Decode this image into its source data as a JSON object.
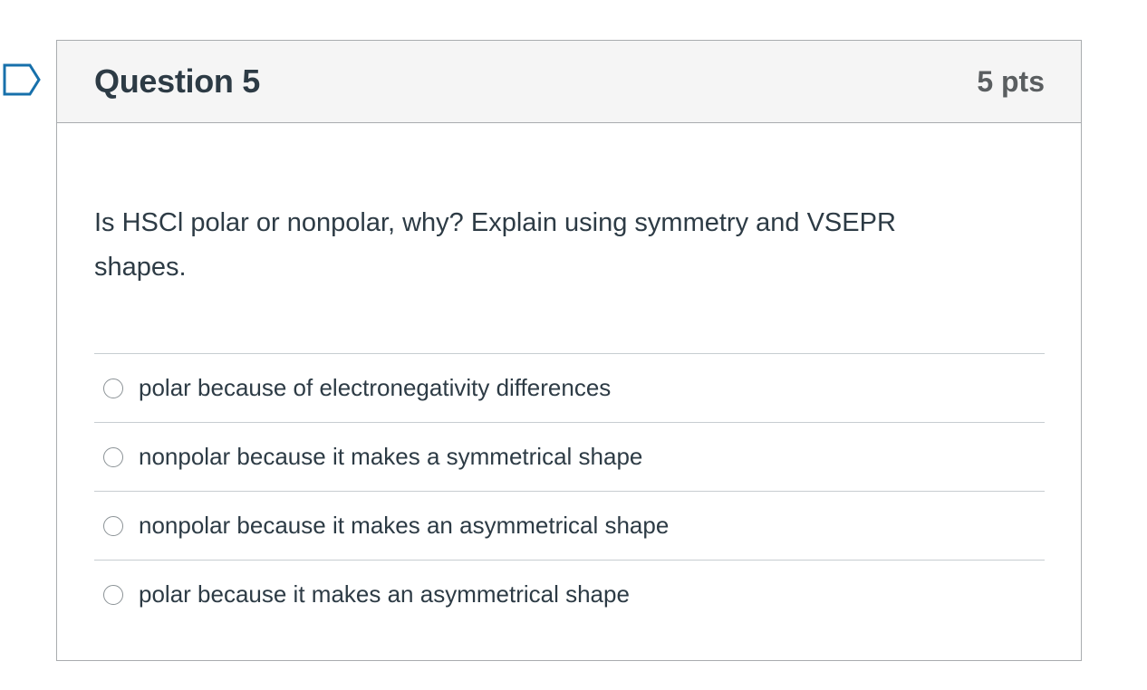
{
  "question": {
    "title": "Question 5",
    "points": "5 pts",
    "text": "Is HSCl polar or nonpolar, why? Explain using symmetry and VSEPR shapes.",
    "flag_icon": "bookmark-flag-icon",
    "answers": [
      {
        "label": "polar because of electronegativity differences",
        "selected": false
      },
      {
        "label": "nonpolar because it makes a symmetrical shape",
        "selected": false
      },
      {
        "label": "nonpolar because it makes an asymmetrical shape",
        "selected": false
      },
      {
        "label": "polar because it makes an asymmetrical shape",
        "selected": false
      }
    ]
  },
  "colors": {
    "header_bg": "#f5f5f5",
    "border": "#a9acaf",
    "text": "#2d3b45",
    "flag": "#1770ab"
  }
}
